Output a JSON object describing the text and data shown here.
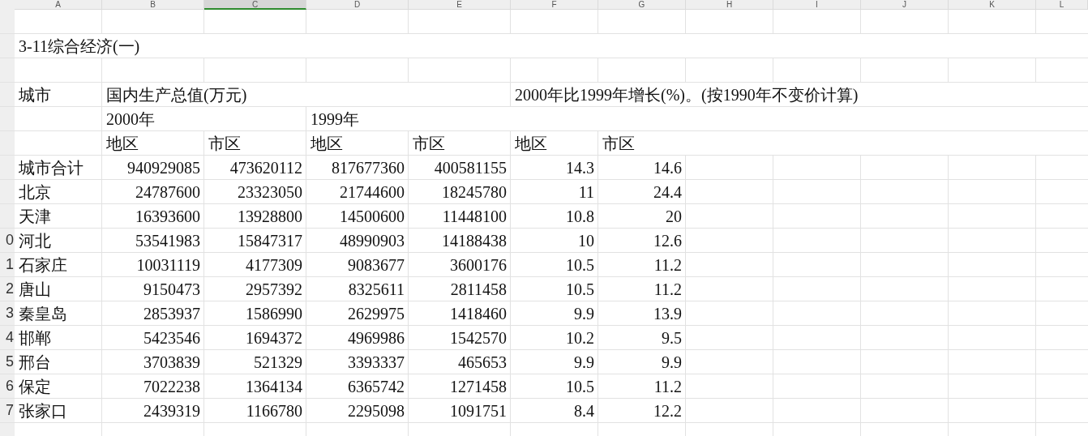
{
  "columns": [
    {
      "label": "A",
      "selected": false
    },
    {
      "label": "B",
      "selected": false
    },
    {
      "label": "C",
      "selected": true
    },
    {
      "label": "D",
      "selected": false
    },
    {
      "label": "E",
      "selected": false
    },
    {
      "label": "F",
      "selected": false
    },
    {
      "label": "G",
      "selected": false
    },
    {
      "label": "H",
      "selected": false
    },
    {
      "label": "I",
      "selected": false
    },
    {
      "label": "J",
      "selected": false
    },
    {
      "label": "K",
      "selected": false
    },
    {
      "label": "L",
      "selected": false
    }
  ],
  "rows": [
    {
      "kind": "header"
    },
    {
      "kind": "header",
      "cells": {
        "A": "3-11综合经济(一)"
      }
    },
    {
      "kind": "header"
    },
    {
      "kind": "header",
      "cells": {
        "A": "城市",
        "B": "国内生产总值(万元)",
        "F": "2000年比1999年增长(%)。(按1990年不变价计算)"
      }
    },
    {
      "kind": "header",
      "cells": {
        "B": "2000年",
        "D": "1999年"
      }
    },
    {
      "kind": "header",
      "cells": {
        "B": "地区",
        "C": "市区",
        "D": "地区",
        "E": "市区",
        "F": "地区",
        "G": "市区"
      }
    },
    {
      "kind": "data",
      "cells": {
        "A": "城市合计",
        "B": "940929085",
        "C": "473620112",
        "D": "817677360",
        "E": "400581155",
        "F": "14.3",
        "G": "14.6"
      }
    },
    {
      "kind": "data",
      "cells": {
        "A": "北京",
        "B": "24787600",
        "C": "23323050",
        "D": "21744600",
        "E": "18245780",
        "F": "11",
        "G": "24.4"
      }
    },
    {
      "kind": "data",
      "cells": {
        "A": "天津",
        "B": "16393600",
        "C": "13928800",
        "D": "14500600",
        "E": "11448100",
        "F": "10.8",
        "G": "20"
      }
    },
    {
      "kind": "data",
      "row_number": "0",
      "cells": {
        "A": "河北",
        "B": "53541983",
        "C": "15847317",
        "D": "48990903",
        "E": "14188438",
        "F": "10",
        "G": "12.6"
      }
    },
    {
      "kind": "data",
      "row_number": "1",
      "cells": {
        "A": "石家庄",
        "B": "10031119",
        "C": "4177309",
        "D": "9083677",
        "E": "3600176",
        "F": "10.5",
        "G": "11.2"
      }
    },
    {
      "kind": "data",
      "row_number": "2",
      "cells": {
        "A": "唐山",
        "B": "9150473",
        "C": "2957392",
        "D": "8325611",
        "E": "2811458",
        "F": "10.5",
        "G": "11.2"
      }
    },
    {
      "kind": "data",
      "row_number": "3",
      "cells": {
        "A": "秦皇岛",
        "B": "2853937",
        "C": "1586990",
        "D": "2629975",
        "E": "1418460",
        "F": "9.9",
        "G": "13.9"
      }
    },
    {
      "kind": "data",
      "row_number": "4",
      "cells": {
        "A": "邯郸",
        "B": "5423546",
        "C": "1694372",
        "D": "4969986",
        "E": "1542570",
        "F": "10.2",
        "G": "9.5"
      }
    },
    {
      "kind": "data",
      "row_number": "5",
      "cells": {
        "A": "邢台",
        "B": "3703839",
        "C": "521329",
        "D": "3393337",
        "E": "465653",
        "F": "9.9",
        "G": "9.9"
      }
    },
    {
      "kind": "data",
      "row_number": "6",
      "cells": {
        "A": "保定",
        "B": "7022238",
        "C": "1364134",
        "D": "6365742",
        "E": "1271458",
        "F": "10.5",
        "G": "11.2"
      }
    },
    {
      "kind": "data",
      "row_number": "7",
      "cells": {
        "A": "张家口",
        "B": "2439319",
        "C": "1166780",
        "D": "2295098",
        "E": "1091751",
        "F": "8.4",
        "G": "12.2"
      }
    }
  ]
}
